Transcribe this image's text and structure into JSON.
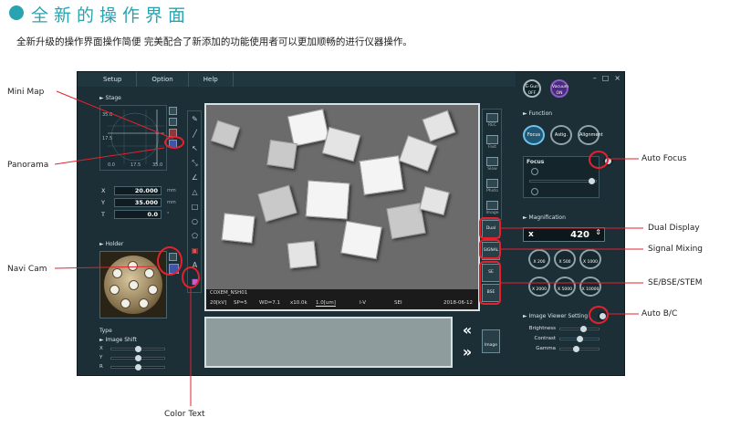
{
  "header": {
    "title": "全新的操作界面",
    "subtitle": "全新升级的操作界面操作简便 完美配合了新添加的功能使用者可以更加顺畅的进行仪器操作。"
  },
  "app": {
    "menu": [
      "Setup",
      "Option",
      "Help"
    ],
    "window_controls": [
      "–",
      "□",
      "×"
    ],
    "stage": {
      "label": "► Stage",
      "ticks_y": [
        "35.0",
        "17.5",
        "0.0"
      ],
      "ticks_x": [
        "0.0",
        "17.5",
        "35.0"
      ],
      "x_label": "X",
      "x_value": "20.000",
      "x_unit": "mm",
      "y_label": "Y",
      "y_value": "35.000",
      "y_unit": "mm",
      "t_label": "T",
      "t_value": "0.0",
      "t_unit": "°"
    },
    "holder": {
      "label": "► Holder",
      "type_label": "Type"
    },
    "image_shift": {
      "label": "► Image Shift",
      "rows": [
        {
          "label": "X",
          "level": 0.5
        },
        {
          "label": "Y",
          "level": 0.5
        },
        {
          "label": "R",
          "level": 0.5
        }
      ]
    },
    "viewer_info": {
      "name": "COXEM_NSH01",
      "kv": "20[kV]",
      "spot": "SP=5",
      "wd": "WD=7.1",
      "mag": "x10.0k",
      "scale": "1.0[um]",
      "det1": "I-V",
      "det2": "SEI",
      "date": "2018-06-12"
    },
    "thumbs": {
      "prev": "«",
      "next": "»",
      "image_label": "Image"
    },
    "right_icons": [
      "REC",
      "Fast",
      "Slow",
      "Photo",
      "Image"
    ],
    "detector_buttons": [
      "Dual",
      "SIGNAL",
      "SE",
      "BSE"
    ],
    "controls": {
      "egun": "E-Gun\nOFF",
      "vacuum": "Vacuum\nON",
      "function_label": "► Function",
      "function_buttons": [
        "Focus",
        "Astig.",
        "Alignment"
      ],
      "focus_label": "Focus",
      "magnification_label": "► Magnification",
      "mag_prefix": "x",
      "mag_value": "420",
      "zoom_buttons": [
        "X 200",
        "X 500",
        "X 1000",
        "X 2000",
        "X 5000",
        "X 10000"
      ],
      "image_viewer_label": "► Image Viewer Setting",
      "iv_rows": [
        {
          "label": "Brightness",
          "level": 0.55
        },
        {
          "label": "Contrast",
          "level": 0.45
        },
        {
          "label": "Gamma",
          "level": 0.35
        }
      ]
    }
  },
  "annotations": {
    "mini_map": "Mini Map",
    "panorama": "Panorama",
    "navi_cam": "Navi Cam",
    "color_text": "Color Text",
    "auto_focus": "Auto Focus",
    "dual_display": "Dual Display",
    "signal_mixing": "Signal Mixing",
    "se_bse_stem": "SE/BSE/STEM",
    "auto_bc": "Auto B/C"
  },
  "colors": {
    "accent": "#2aa3b0",
    "callout": "#e5212e",
    "app_bg": "#1d2f36"
  }
}
